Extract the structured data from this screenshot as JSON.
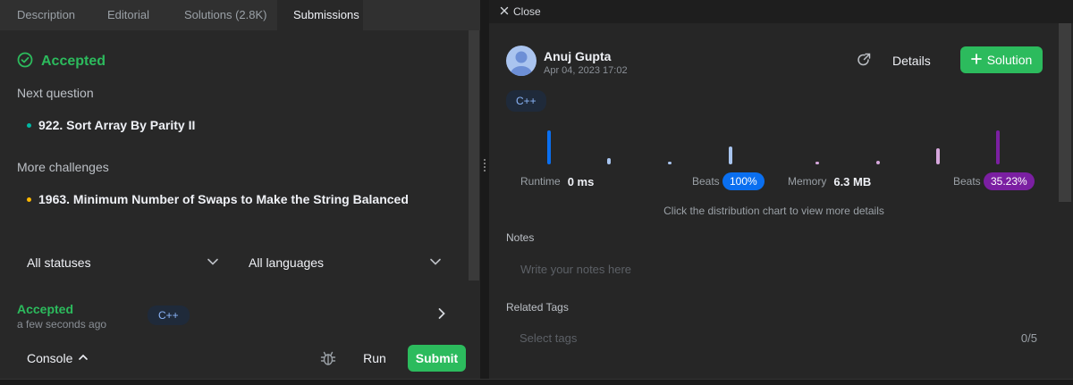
{
  "tabs": [
    {
      "label": "Description"
    },
    {
      "label": "Editorial"
    },
    {
      "label": "Solutions (2.8K)"
    },
    {
      "label": "Submissions"
    }
  ],
  "result": {
    "status": "Accepted",
    "next_label": "Next question",
    "next_item": "922. Sort Array By Parity II",
    "more_label": "More challenges",
    "more_item": "1963. Minimum Number of Swaps to Make the String Balanced"
  },
  "filters": {
    "status": "All statuses",
    "language": "All languages"
  },
  "submission": {
    "status": "Accepted",
    "time": "a few seconds ago",
    "language": "C++"
  },
  "console": {
    "label": "Console",
    "run": "Run",
    "submit": "Submit"
  },
  "detail": {
    "close": "Close",
    "user_name": "Anuj Gupta",
    "date": "Apr 04, 2023 17:02",
    "details_label": "Details",
    "solution_label": "Solution",
    "language": "C++",
    "runtime_label": "Runtime",
    "runtime_value": "0 ms",
    "runtime_beats_label": "Beats",
    "runtime_beats": "100%",
    "memory_label": "Memory",
    "memory_value": "6.3 MB",
    "memory_beats_label": "Beats",
    "memory_beats": "35.23%",
    "hint": "Click the distribution chart to view more details",
    "notes_label": "Notes",
    "notes_placeholder": "Write your notes here",
    "tags_label": "Related Tags",
    "tags_placeholder": "Select tags",
    "tags_count": "0/5"
  },
  "colors": {
    "accent_green": "#2cbb5d",
    "runtime_blue": "#0a84ff",
    "memory_purple": "#7b1fa2"
  }
}
